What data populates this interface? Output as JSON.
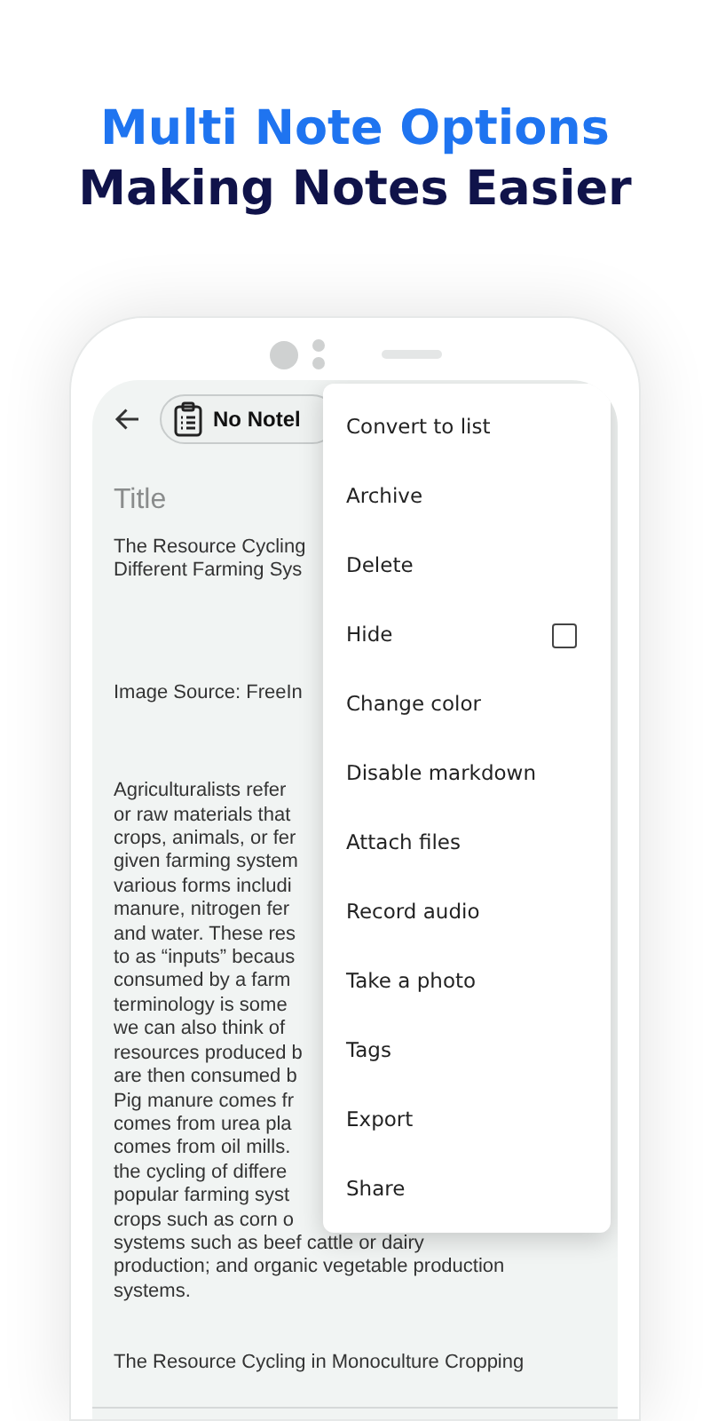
{
  "headline": [
    "Multi Note Options",
    "Making Notes Easier"
  ],
  "toolbar": {
    "notebook_chip": "No Notel"
  },
  "note": {
    "title_placeholder": "Title",
    "blocks": [
      {
        "lines": [
          "The Resource Cycling",
          "Different Farming Sys"
        ]
      },
      {
        "lines": [
          "Image Source: FreeIn"
        ]
      },
      {
        "lines": [
          "Agriculturalists refer",
          "or raw materials that",
          "crops, animals, or fer",
          "given farming system",
          "various forms includi",
          "manure, nitrogen fer",
          "and water. These res",
          "to as “inputs” becaus",
          "consumed by a farm",
          "terminology is some",
          "we can also think of",
          "resources produced b",
          "are then consumed b",
          "Pig manure comes fr",
          "comes from urea pla",
          "comes from oil mills.",
          "the cycling of differe",
          "popular farming syst",
          "crops such as corn o",
          "systems such as beef cattle or dairy",
          "production; and organic vegetable production",
          "systems."
        ]
      },
      {
        "lines": [
          "The Resource Cycling in Monoculture Cropping"
        ]
      }
    ]
  },
  "menu": [
    {
      "label": "Convert to list",
      "kind": "plain"
    },
    {
      "label": "Archive",
      "kind": "plain"
    },
    {
      "label": "Delete",
      "kind": "plain"
    },
    {
      "label": "Hide",
      "kind": "checkbox",
      "checked": false
    },
    {
      "label": "Change color",
      "kind": "plain"
    },
    {
      "label": "Disable markdown",
      "kind": "plain"
    },
    {
      "label": "Attach files",
      "kind": "plain"
    },
    {
      "label": "Record audio",
      "kind": "plain"
    },
    {
      "label": "Take a photo",
      "kind": "plain"
    },
    {
      "label": "Tags",
      "kind": "plain"
    },
    {
      "label": "Export",
      "kind": "plain"
    },
    {
      "label": "Share",
      "kind": "plain"
    }
  ]
}
